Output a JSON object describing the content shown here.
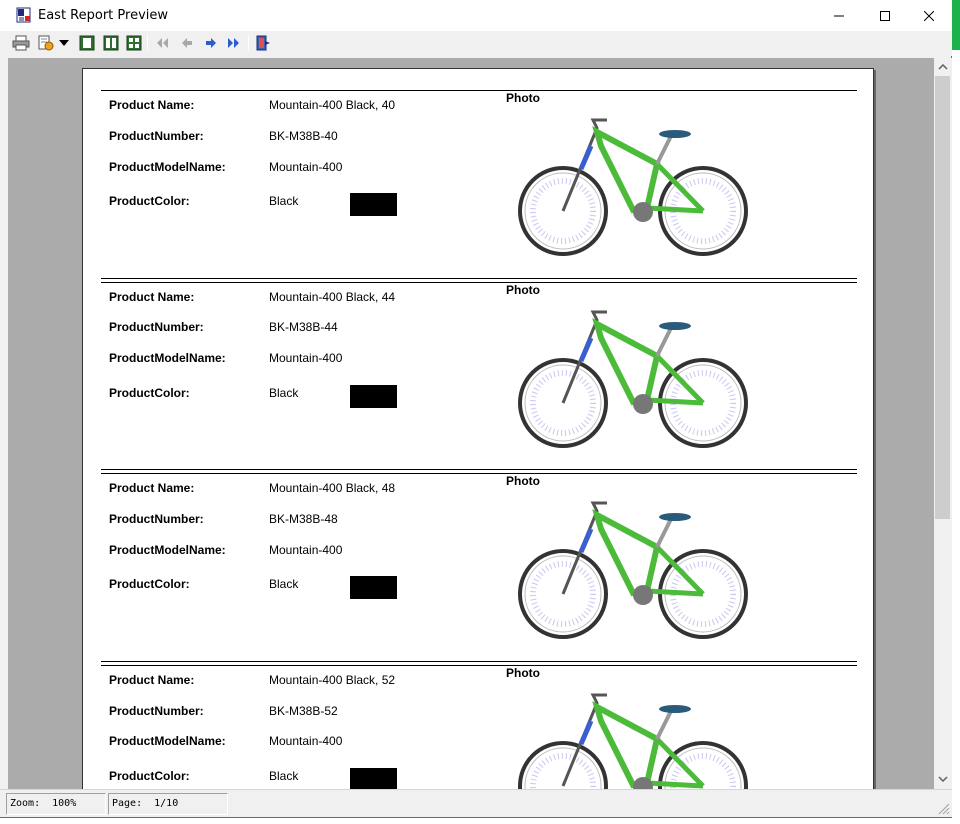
{
  "window": {
    "title": "East Report Preview"
  },
  "toolbar": {
    "buttons": [
      "print-icon",
      "page-setup-icon",
      "dropdown-arrow-icon",
      "single-page-icon",
      "two-pages-icon",
      "multiple-pages-icon",
      "first-page-icon",
      "prev-page-icon",
      "next-page-icon",
      "last-page-icon",
      "close-preview-icon"
    ]
  },
  "labels": {
    "product_name": "Product Name:",
    "product_number": "ProductNumber:",
    "product_model_name": "ProductModelName:",
    "product_color": "ProductColor:",
    "photo": "Photo"
  },
  "records": [
    {
      "name": "Mountain-400 Black, 40",
      "number": "BK-M38B-40",
      "model": "Mountain-400",
      "color": "Black",
      "swatch": "#000000"
    },
    {
      "name": "Mountain-400 Black, 44",
      "number": "BK-M38B-44",
      "model": "Mountain-400",
      "color": "Black",
      "swatch": "#000000"
    },
    {
      "name": "Mountain-400 Black, 48",
      "number": "BK-M38B-48",
      "model": "Mountain-400",
      "color": "Black",
      "swatch": "#000000"
    },
    {
      "name": "Mountain-400 Black, 52",
      "number": "BK-M38B-52",
      "model": "Mountain-400",
      "color": "Black",
      "swatch": "#000000"
    }
  ],
  "status": {
    "zoom": "Zoom:  100%",
    "page": "Page:  1/10"
  },
  "colors": {
    "bike_frame": "#4cbb3a",
    "accent": "#1a7fd0"
  }
}
